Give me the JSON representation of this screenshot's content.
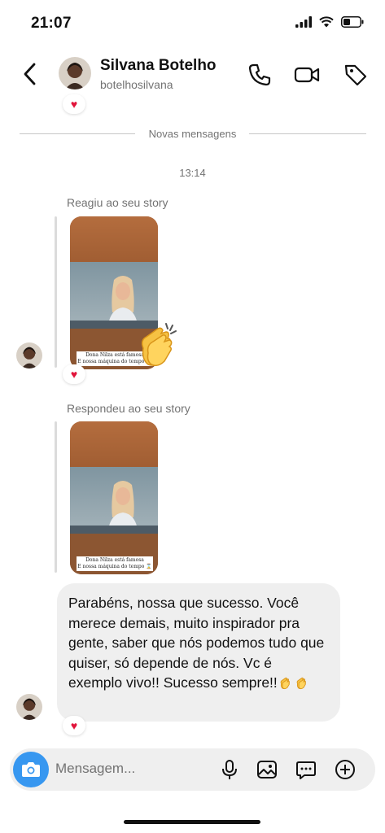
{
  "status": {
    "time": "21:07"
  },
  "header": {
    "name": "Silvana Botelho",
    "username": "botelhosilvana"
  },
  "divider": {
    "label": "Novas mensagens"
  },
  "timestamp": "13:14",
  "messages": [
    {
      "caption": "Reagiu ao seu story",
      "story_caption": [
        "Dona Nilza está famosa",
        "E nossa máquina do tempo ⌛"
      ],
      "reaction": "♥"
    },
    {
      "caption": "Respondeu ao seu story",
      "story_caption": [
        "Dona Nilza está famosa",
        "E nossa máquina do tempo ⌛"
      ]
    },
    {
      "text": "Parabéns, nossa que sucesso. Você merece demais, muito inspirador pra gente, saber que nós podemos tudo que quiser, só depende de nós. Vc é exemplo vivo!! Sucesso sempre!!",
      "reaction": "♥"
    }
  ],
  "top_reaction": "♥",
  "composer": {
    "placeholder": "Mensagem..."
  },
  "icons": [
    "back-icon",
    "phone-icon",
    "video-icon",
    "tag-icon",
    "camera-icon",
    "microphone-icon",
    "gallery-icon",
    "sticker-icon",
    "plus-icon",
    "clapping-hands-icon",
    "heart-icon"
  ],
  "colors": {
    "accent": "#3797f0",
    "heart": "#e1143b",
    "bubble": "#efefef",
    "muted": "#737373"
  }
}
